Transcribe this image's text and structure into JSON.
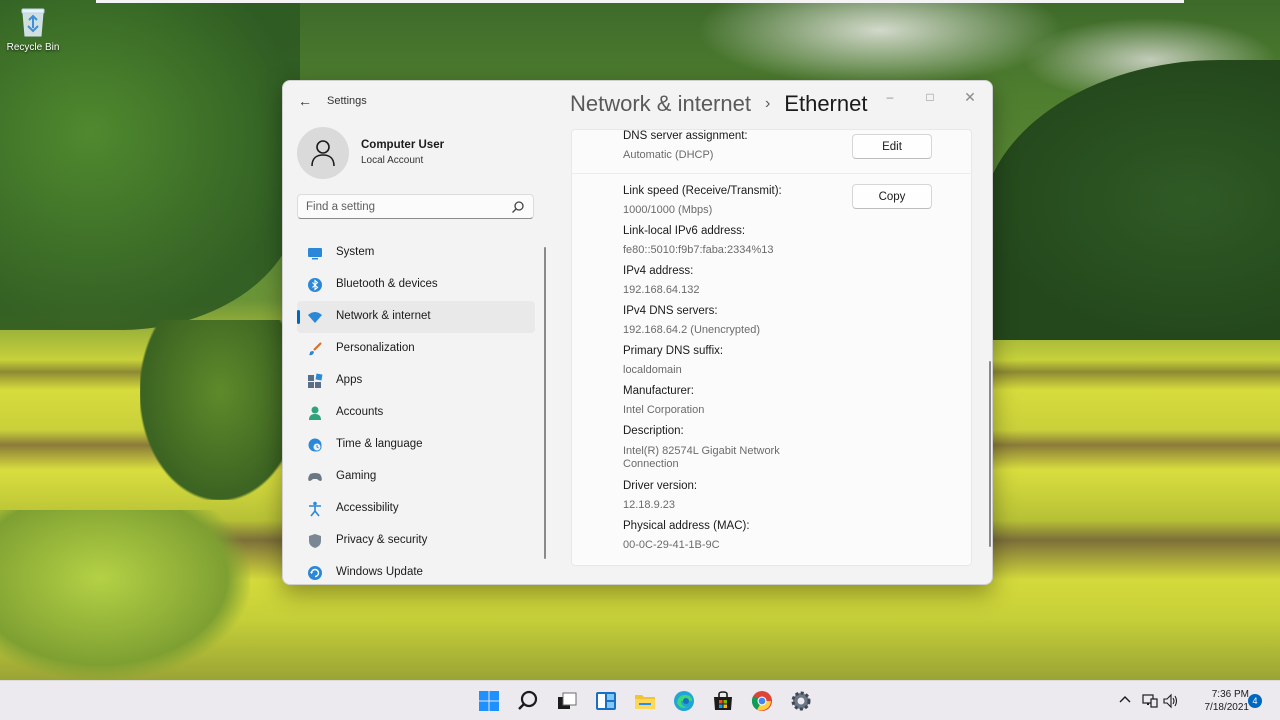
{
  "desktop": {
    "recycle_bin_label": "Recycle Bin"
  },
  "window": {
    "app_title": "Settings",
    "breadcrumb_parent": "Network & internet",
    "breadcrumb_current": "Ethernet"
  },
  "user": {
    "name": "Computer User",
    "account_type": "Local Account"
  },
  "search": {
    "placeholder": "Find a setting"
  },
  "sidebar": {
    "items": [
      {
        "label": "System",
        "icon": "system-icon"
      },
      {
        "label": "Bluetooth & devices",
        "icon": "bluetooth-icon"
      },
      {
        "label": "Network & internet",
        "icon": "wifi-icon",
        "active": true
      },
      {
        "label": "Personalization",
        "icon": "brush-icon"
      },
      {
        "label": "Apps",
        "icon": "apps-icon"
      },
      {
        "label": "Accounts",
        "icon": "person-icon"
      },
      {
        "label": "Time & language",
        "icon": "globe-clock-icon"
      },
      {
        "label": "Gaming",
        "icon": "gamepad-icon"
      },
      {
        "label": "Accessibility",
        "icon": "accessibility-icon"
      },
      {
        "label": "Privacy & security",
        "icon": "shield-icon"
      },
      {
        "label": "Windows Update",
        "icon": "update-icon"
      }
    ]
  },
  "content": {
    "dns_assignment": {
      "label": "DNS server assignment:",
      "value": "Automatic (DHCP)"
    },
    "edit_label": "Edit",
    "copy_label": "Copy",
    "properties": [
      {
        "label": "Link speed (Receive/Transmit):",
        "value": "1000/1000 (Mbps)"
      },
      {
        "label": "Link-local IPv6 address:",
        "value": "fe80::5010:f9b7:faba:2334%13"
      },
      {
        "label": "IPv4 address:",
        "value": "192.168.64.132"
      },
      {
        "label": "IPv4 DNS servers:",
        "value": "192.168.64.2 (Unencrypted)"
      },
      {
        "label": "Primary DNS suffix:",
        "value": "localdomain"
      },
      {
        "label": "Manufacturer:",
        "value": "Intel Corporation"
      },
      {
        "label": "Description:",
        "value": "Intel(R) 82574L Gigabit Network",
        "value2": "Connection"
      },
      {
        "label": "Driver version:",
        "value": "12.18.9.23"
      },
      {
        "label": "Physical address (MAC):",
        "value": "00-0C-29-41-1B-9C"
      }
    ]
  },
  "taskbar": {
    "time": "7:36 PM",
    "date": "7/18/2021",
    "notification_count": "4",
    "accent": "#0067c0"
  }
}
